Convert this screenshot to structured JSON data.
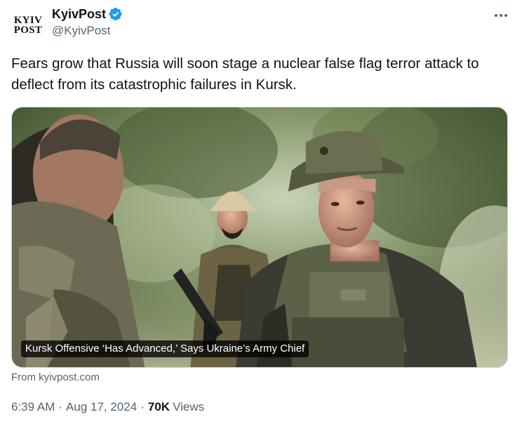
{
  "author": {
    "avatar_line1": "KYIV",
    "avatar_line2": "POST",
    "display_name": "KyivPost",
    "handle": "@KyivPost",
    "verified_color": "#1d9bf0"
  },
  "tweet": {
    "text": "Fears grow that Russia will soon stage a nuclear false flag terror attack to deflect from its catastrophic failures in Kursk."
  },
  "card": {
    "title": "Kursk Offensive ‘Has Advanced,’ Says Ukraine’s Army Chief",
    "source": "From kyivpost.com"
  },
  "meta": {
    "time": "6:39 AM",
    "date": "Aug 17, 2024",
    "views_count": "70K",
    "views_label": "Views",
    "separator": "·"
  },
  "icons": {
    "more": "more-options-icon",
    "verified": "verified-badge-icon"
  }
}
